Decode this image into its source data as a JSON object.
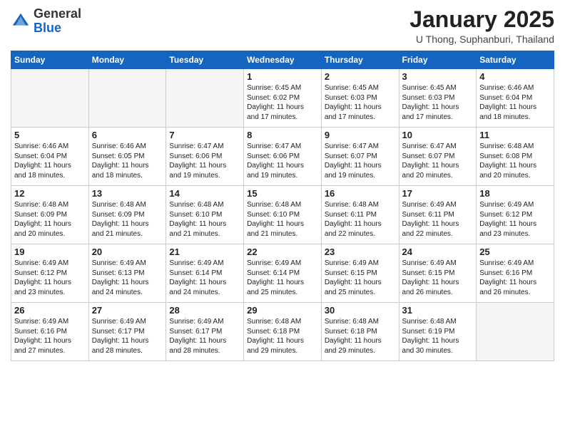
{
  "header": {
    "logo_general": "General",
    "logo_blue": "Blue",
    "month_title": "January 2025",
    "location": "U Thong, Suphanburi, Thailand"
  },
  "days_of_week": [
    "Sunday",
    "Monday",
    "Tuesday",
    "Wednesday",
    "Thursday",
    "Friday",
    "Saturday"
  ],
  "weeks": [
    [
      {
        "day": "",
        "info": ""
      },
      {
        "day": "",
        "info": ""
      },
      {
        "day": "",
        "info": ""
      },
      {
        "day": "1",
        "info": "Sunrise: 6:45 AM\nSunset: 6:02 PM\nDaylight: 11 hours\nand 17 minutes."
      },
      {
        "day": "2",
        "info": "Sunrise: 6:45 AM\nSunset: 6:03 PM\nDaylight: 11 hours\nand 17 minutes."
      },
      {
        "day": "3",
        "info": "Sunrise: 6:45 AM\nSunset: 6:03 PM\nDaylight: 11 hours\nand 17 minutes."
      },
      {
        "day": "4",
        "info": "Sunrise: 6:46 AM\nSunset: 6:04 PM\nDaylight: 11 hours\nand 18 minutes."
      }
    ],
    [
      {
        "day": "5",
        "info": "Sunrise: 6:46 AM\nSunset: 6:04 PM\nDaylight: 11 hours\nand 18 minutes."
      },
      {
        "day": "6",
        "info": "Sunrise: 6:46 AM\nSunset: 6:05 PM\nDaylight: 11 hours\nand 18 minutes."
      },
      {
        "day": "7",
        "info": "Sunrise: 6:47 AM\nSunset: 6:06 PM\nDaylight: 11 hours\nand 19 minutes."
      },
      {
        "day": "8",
        "info": "Sunrise: 6:47 AM\nSunset: 6:06 PM\nDaylight: 11 hours\nand 19 minutes."
      },
      {
        "day": "9",
        "info": "Sunrise: 6:47 AM\nSunset: 6:07 PM\nDaylight: 11 hours\nand 19 minutes."
      },
      {
        "day": "10",
        "info": "Sunrise: 6:47 AM\nSunset: 6:07 PM\nDaylight: 11 hours\nand 20 minutes."
      },
      {
        "day": "11",
        "info": "Sunrise: 6:48 AM\nSunset: 6:08 PM\nDaylight: 11 hours\nand 20 minutes."
      }
    ],
    [
      {
        "day": "12",
        "info": "Sunrise: 6:48 AM\nSunset: 6:09 PM\nDaylight: 11 hours\nand 20 minutes."
      },
      {
        "day": "13",
        "info": "Sunrise: 6:48 AM\nSunset: 6:09 PM\nDaylight: 11 hours\nand 21 minutes."
      },
      {
        "day": "14",
        "info": "Sunrise: 6:48 AM\nSunset: 6:10 PM\nDaylight: 11 hours\nand 21 minutes."
      },
      {
        "day": "15",
        "info": "Sunrise: 6:48 AM\nSunset: 6:10 PM\nDaylight: 11 hours\nand 21 minutes."
      },
      {
        "day": "16",
        "info": "Sunrise: 6:48 AM\nSunset: 6:11 PM\nDaylight: 11 hours\nand 22 minutes."
      },
      {
        "day": "17",
        "info": "Sunrise: 6:49 AM\nSunset: 6:11 PM\nDaylight: 11 hours\nand 22 minutes."
      },
      {
        "day": "18",
        "info": "Sunrise: 6:49 AM\nSunset: 6:12 PM\nDaylight: 11 hours\nand 23 minutes."
      }
    ],
    [
      {
        "day": "19",
        "info": "Sunrise: 6:49 AM\nSunset: 6:12 PM\nDaylight: 11 hours\nand 23 minutes."
      },
      {
        "day": "20",
        "info": "Sunrise: 6:49 AM\nSunset: 6:13 PM\nDaylight: 11 hours\nand 24 minutes."
      },
      {
        "day": "21",
        "info": "Sunrise: 6:49 AM\nSunset: 6:14 PM\nDaylight: 11 hours\nand 24 minutes."
      },
      {
        "day": "22",
        "info": "Sunrise: 6:49 AM\nSunset: 6:14 PM\nDaylight: 11 hours\nand 25 minutes."
      },
      {
        "day": "23",
        "info": "Sunrise: 6:49 AM\nSunset: 6:15 PM\nDaylight: 11 hours\nand 25 minutes."
      },
      {
        "day": "24",
        "info": "Sunrise: 6:49 AM\nSunset: 6:15 PM\nDaylight: 11 hours\nand 26 minutes."
      },
      {
        "day": "25",
        "info": "Sunrise: 6:49 AM\nSunset: 6:16 PM\nDaylight: 11 hours\nand 26 minutes."
      }
    ],
    [
      {
        "day": "26",
        "info": "Sunrise: 6:49 AM\nSunset: 6:16 PM\nDaylight: 11 hours\nand 27 minutes."
      },
      {
        "day": "27",
        "info": "Sunrise: 6:49 AM\nSunset: 6:17 PM\nDaylight: 11 hours\nand 28 minutes."
      },
      {
        "day": "28",
        "info": "Sunrise: 6:49 AM\nSunset: 6:17 PM\nDaylight: 11 hours\nand 28 minutes."
      },
      {
        "day": "29",
        "info": "Sunrise: 6:48 AM\nSunset: 6:18 PM\nDaylight: 11 hours\nand 29 minutes."
      },
      {
        "day": "30",
        "info": "Sunrise: 6:48 AM\nSunset: 6:18 PM\nDaylight: 11 hours\nand 29 minutes."
      },
      {
        "day": "31",
        "info": "Sunrise: 6:48 AM\nSunset: 6:19 PM\nDaylight: 11 hours\nand 30 minutes."
      },
      {
        "day": "",
        "info": ""
      }
    ]
  ]
}
